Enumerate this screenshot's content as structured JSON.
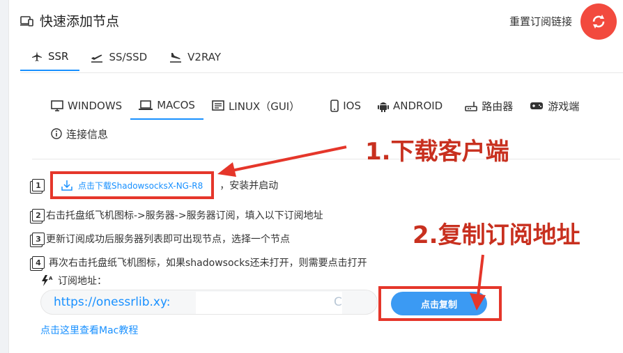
{
  "header": {
    "title": "快速添加节点",
    "reset_link": "重置订阅链接"
  },
  "protocol_tabs": [
    {
      "label": "SSR",
      "icon": "plane-icon",
      "active": true
    },
    {
      "label": "SS/SSD",
      "icon": "plane-takeoff-icon",
      "active": false
    },
    {
      "label": "V2RAY",
      "icon": "plane-landing-icon",
      "active": false
    }
  ],
  "os_tabs": [
    {
      "label": "WINDOWS",
      "icon": "monitor-icon",
      "active": false
    },
    {
      "label": "MACOS",
      "icon": "laptop-icon",
      "active": true
    },
    {
      "label": "LINUX（GUI）",
      "icon": "terminal-icon",
      "active": false
    },
    {
      "label": "IOS",
      "icon": "phone-icon",
      "active": false
    },
    {
      "label": "ANDROID",
      "icon": "android-icon",
      "active": false
    },
    {
      "label": "路由器",
      "icon": "router-icon",
      "active": false
    },
    {
      "label": "游戏端",
      "icon": "gamepad-icon",
      "active": false
    },
    {
      "label": "连接信息",
      "icon": "info-icon",
      "active": false
    }
  ],
  "steps": {
    "s1_num": "1",
    "s1_button": "点击下载ShadowsocksX-NG-R8",
    "s1_suffix": "，安装并启动",
    "s2_num": "2",
    "s2_text": "右击托盘纸飞机图标->服务器->服务器订阅，填入以下订阅地址",
    "s3_num": "3",
    "s3_text": "更新订阅成功后服务器列表即可出现节点，选择一个节点",
    "s4_num": "4",
    "s4_text": "再次右击托盘纸飞机图标，如果shadowsocks还未打开，则需要点击打开"
  },
  "subscription": {
    "label": "订阅地址：",
    "value": "https://onessrlib.xy:",
    "tail": "C",
    "copy_button": "点击复制"
  },
  "mac_tutorial_link": "点击这里查看Mac教程",
  "annotations": {
    "step1": "1.下载客户端",
    "step2": "2.复制订阅地址"
  },
  "colors": {
    "accent": "#1890ff",
    "refresh_button": "#f24a3e",
    "annotation_red": "#c8301f"
  }
}
